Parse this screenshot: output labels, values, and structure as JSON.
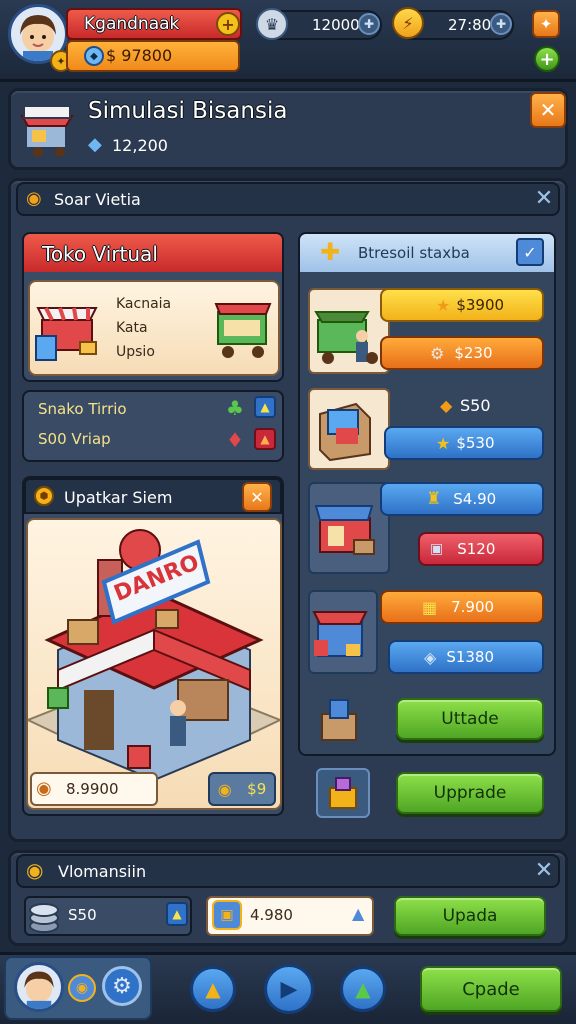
{
  "top_bar": {
    "player_name": "Kgandnaak",
    "player_money": "$ 97800",
    "stat_one": "12000",
    "stat_two": "27:80"
  },
  "header": {
    "title": "Simulasi Bisansia",
    "gems": "12,200"
  },
  "main_panel": {
    "title": "Soar Vietia"
  },
  "toko": {
    "title": "Toko Virtual",
    "lines": [
      "Kacnaia",
      "Kata",
      "Upsio"
    ],
    "stat_one": "Snako Tirrio",
    "stat_two": "S00 Vriap"
  },
  "upgrade_preview": {
    "title": "Upatkar Siem",
    "sign": "DANRO",
    "price": "8.9900",
    "cost": "$9"
  },
  "shop_list": {
    "title": "Btresoil staxba",
    "items": [
      {
        "top_price": "$3900",
        "bottom_price": "$230"
      },
      {
        "top_price": "S50",
        "bottom_price": "$530"
      },
      {
        "top_price": "S4.90",
        "bottom_price": "S120"
      },
      {
        "top_price": "7.900",
        "bottom_price": "S1380"
      }
    ],
    "upgrade_one": "Uttade",
    "upgrade_two": "Upprade"
  },
  "bottom_panel": {
    "title": "Vlomansiin",
    "count_one": "S50",
    "count_two": "4.980",
    "action": "Upada"
  },
  "nav": {
    "action": "Cpade"
  }
}
